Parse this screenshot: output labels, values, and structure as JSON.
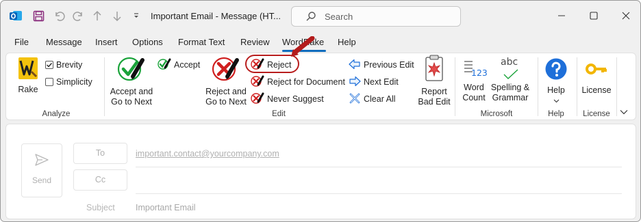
{
  "window": {
    "title": "Important Email  -  Message (HT...",
    "search_placeholder": "Search"
  },
  "tabs": [
    "File",
    "Message",
    "Insert",
    "Options",
    "Format Text",
    "Review",
    "WordRake",
    "Help"
  ],
  "active_tab": "WordRake",
  "ribbon": {
    "analyze": {
      "label": "Analyze",
      "rake": "Rake",
      "brevity": {
        "label": "Brevity",
        "checked": true
      },
      "simplicity": {
        "label": "Simplicity",
        "checked": false
      }
    },
    "edit": {
      "label": "Edit",
      "accept_and_go": [
        "Accept and",
        "Go to Next"
      ],
      "accept": "Accept",
      "reject_and_go": [
        "Reject and",
        "Go to Next"
      ],
      "reject": "Reject",
      "reject_for_document": "Reject for Document",
      "never_suggest": "Never Suggest",
      "previous_edit": "Previous Edit",
      "next_edit": "Next Edit",
      "clear_all": "Clear All",
      "report_bad_edit": [
        "Report",
        "Bad Edit"
      ]
    },
    "microsoft": {
      "label": "Microsoft",
      "word_count": [
        "Word",
        "Count"
      ],
      "word_count_icon_text": "123",
      "spelling_grammar": [
        "Spelling &",
        "Grammar"
      ],
      "spelling_icon_text": "abc"
    },
    "help": {
      "label": "Help",
      "help": "Help"
    },
    "license": {
      "label": "License",
      "license": "License"
    }
  },
  "compose": {
    "send": "Send",
    "to_button": "To",
    "cc_button": "Cc",
    "to_value": "important.contact@yourcompany.com",
    "subject_label": "Subject",
    "subject_value": "Important Email"
  },
  "colors": {
    "accent": "#0f6cbd",
    "accept_green": "#1aa33a",
    "reject_red": "#d02020",
    "highlight_red": "#b81d1d",
    "help_blue": "#1e6fd9",
    "license_gold": "#f2b600"
  }
}
